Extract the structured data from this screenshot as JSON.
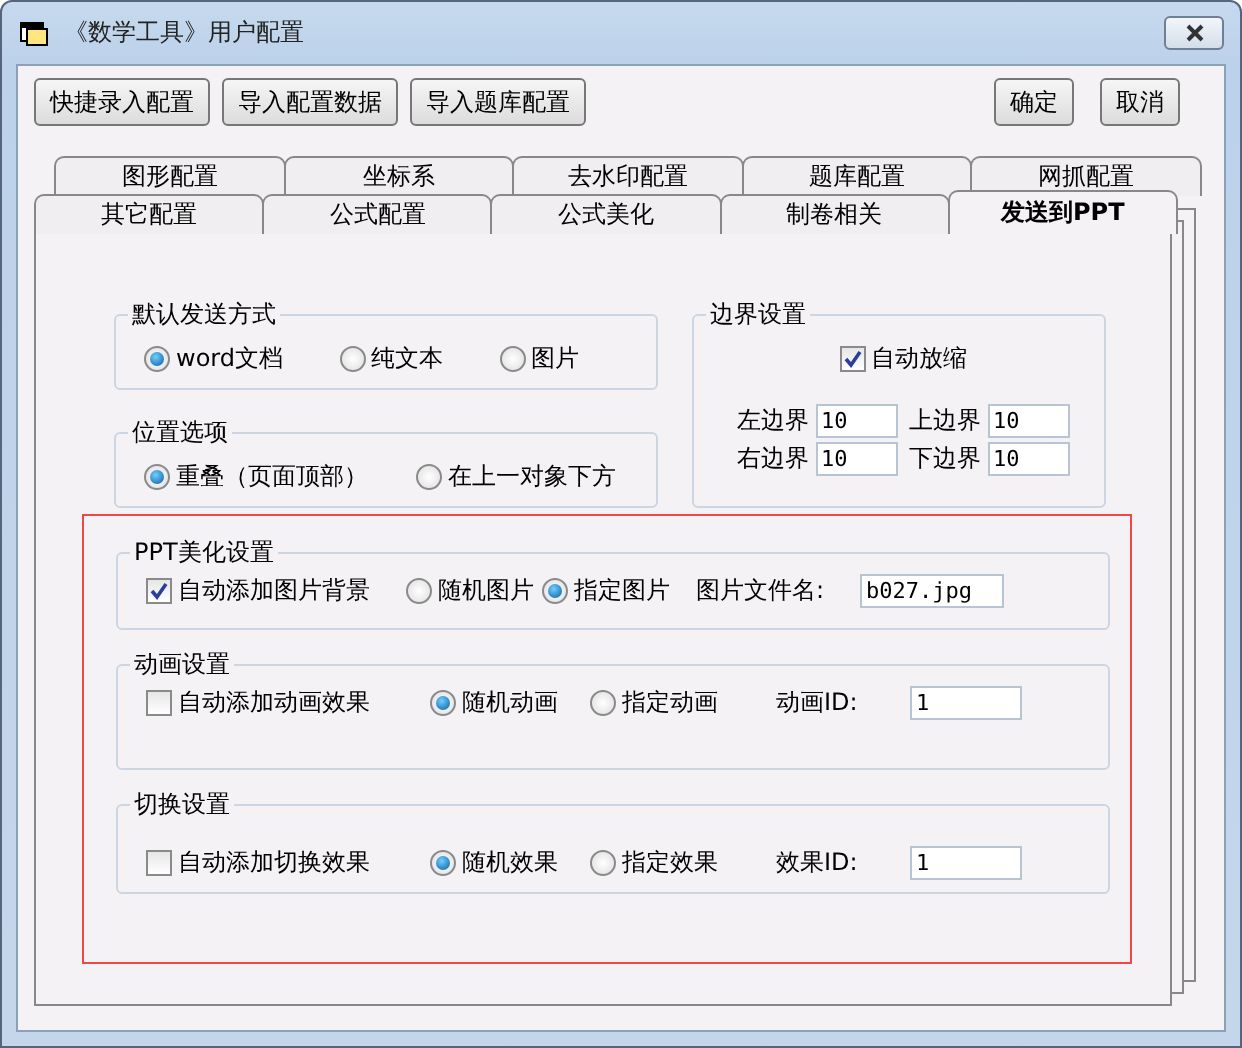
{
  "window": {
    "title": "《数学工具》用户配置"
  },
  "toolbar_buttons": [
    "快捷录入配置",
    "导入配置数据",
    "导入题库配置"
  ],
  "dialog_buttons": [
    "确定",
    "取消"
  ],
  "tab_rows": [
    {
      "tabs": [
        {
          "label": "图形配置",
          "selected": false
        },
        {
          "label": "坐标系",
          "selected": false
        },
        {
          "label": "去水印配置",
          "selected": false
        },
        {
          "label": "题库配置",
          "selected": false
        },
        {
          "label": "网抓配置",
          "selected": false
        }
      ]
    },
    {
      "tabs": [
        {
          "label": "其它配置",
          "selected": false
        },
        {
          "label": "公式配置",
          "selected": false
        },
        {
          "label": "公式美化",
          "selected": false
        },
        {
          "label": "制卷相关",
          "selected": false
        },
        {
          "label": "发送到PPT",
          "selected": true
        }
      ]
    }
  ],
  "send_mode": {
    "title": "默认发送方式",
    "options": [
      {
        "label": "word文档",
        "selected": true
      },
      {
        "label": "纯文本",
        "selected": false
      },
      {
        "label": "图片",
        "selected": false
      }
    ]
  },
  "position": {
    "title": "位置选项",
    "options": [
      {
        "label": "重叠（页面顶部）",
        "selected": true
      },
      {
        "label": "在上一对象下方",
        "selected": false
      }
    ]
  },
  "margins": {
    "title": "边界设置",
    "auto_scale": {
      "label": "自动放缩",
      "checked": true
    },
    "fields": [
      {
        "label": "左边界",
        "value": "10"
      },
      {
        "label": "上边界",
        "value": "10"
      },
      {
        "label": "右边界",
        "value": "10"
      },
      {
        "label": "下边界",
        "value": "10"
      }
    ]
  },
  "ppt_area": {
    "highlighted": true,
    "sections": [
      {
        "title": "PPT美化设置",
        "checkbox": {
          "label": "自动添加图片背景",
          "checked": true
        },
        "options": [
          {
            "label": "随机图片",
            "selected": false
          },
          {
            "label": "指定图片",
            "selected": true
          }
        ],
        "field": {
          "label": "图片文件名:",
          "value": "b027.jpg"
        }
      },
      {
        "title": "动画设置",
        "checkbox": {
          "label": "自动添加动画效果",
          "checked": false
        },
        "options": [
          {
            "label": "随机动画",
            "selected": true
          },
          {
            "label": "指定动画",
            "selected": false
          }
        ],
        "field": {
          "label": "动画ID:",
          "value": "1"
        }
      },
      {
        "title": "切换设置",
        "checkbox": {
          "label": "自动添加切换效果",
          "checked": false
        },
        "options": [
          {
            "label": "随机效果",
            "selected": true
          },
          {
            "label": "指定效果",
            "selected": false
          }
        ],
        "field": {
          "label": "效果ID:",
          "value": "1"
        }
      }
    ]
  }
}
